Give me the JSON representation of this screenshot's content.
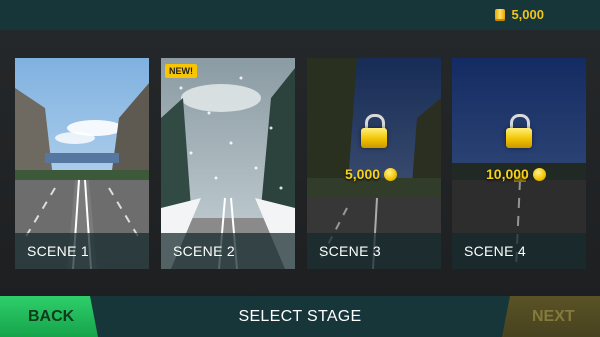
{
  "header": {
    "coin_balance": "5,000",
    "coin_icon": "coin-stack-icon"
  },
  "scenes": [
    {
      "label": "SCENE 1",
      "locked": false,
      "price": null,
      "badge": null
    },
    {
      "label": "SCENE 2",
      "locked": false,
      "price": null,
      "badge": "NEW!"
    },
    {
      "label": "SCENE 3",
      "locked": true,
      "price": "5,000",
      "badge": null
    },
    {
      "label": "SCENE 4",
      "locked": true,
      "price": "10,000",
      "badge": null
    }
  ],
  "footer": {
    "back_label": "BACK",
    "title": "SELECT STAGE",
    "next_label": "NEXT",
    "next_enabled": false
  },
  "colors": {
    "bar": "#17363a",
    "back_green": "#2ecf6b",
    "coin_gold": "#f0c419",
    "next_disabled": "#5a5326"
  }
}
